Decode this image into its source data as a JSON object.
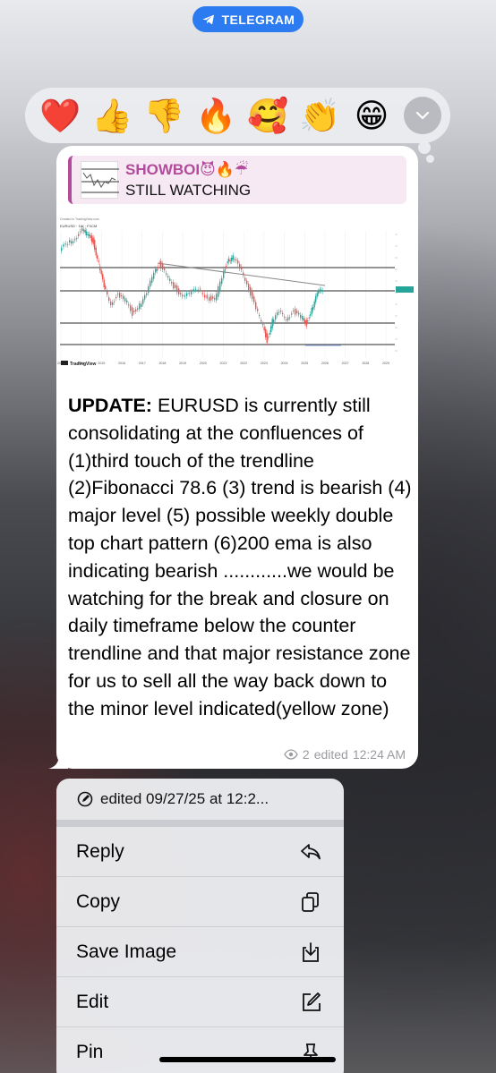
{
  "app_pill": {
    "label": "TELEGRAM"
  },
  "reactions": [
    "❤️",
    "👍",
    "👎",
    "🔥",
    "🥰",
    "👏",
    "😁"
  ],
  "message": {
    "reply": {
      "name": "SHOWBOI😈🔥☔",
      "text": "STILL WATCHING"
    },
    "chart": {
      "header_text": "Created in TradingView.com",
      "symbol_text": "EURUSD · 1W · FXCM",
      "logo_text": "TradingView",
      "x_labels": [
        "2013",
        "2014",
        "2015",
        "2016",
        "2017",
        "2018",
        "2019",
        "2020",
        "2021",
        "2022",
        "2023",
        "2024",
        "2025",
        "2026",
        "2027",
        "2028",
        "2029"
      ]
    },
    "text_bold": "UPDATE:",
    "text_body": " EURUSD is currently still consolidating at the confluences of (1)third touch of the trendline (2)Fibonacci 78.6 (3) trend is bearish (4) major level (5) possible weekly double top chart pattern (6)200 ema is also indicating bearish ............we would be watching for the break and closure on daily timeframe below the counter trendline and that major resistance zone for us to sell all the way back down to the minor level indicated(yellow zone)",
    "meta": {
      "views": "2",
      "status": "edited",
      "time": "12:24 AM"
    }
  },
  "context_menu": {
    "header": "edited 09/27/25 at 12:2...",
    "items": [
      {
        "label": "Reply",
        "icon": "reply-icon"
      },
      {
        "label": "Copy",
        "icon": "copy-icon"
      },
      {
        "label": "Save Image",
        "icon": "save-image-icon"
      },
      {
        "label": "Edit",
        "icon": "edit-icon"
      },
      {
        "label": "Pin",
        "icon": "pin-icon"
      }
    ]
  },
  "colors": {
    "telegram_blue": "#2d7bf0",
    "reply_accent": "#b24b9b",
    "reply_bg": "#f6e9f3",
    "bullish_candle": "#26a69a",
    "bearish_candle": "#ef5350"
  }
}
